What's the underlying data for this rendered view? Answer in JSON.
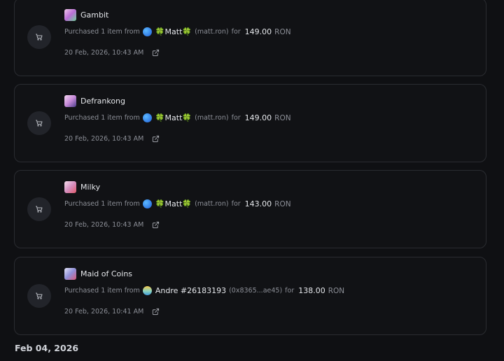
{
  "purchases": [
    {
      "item": "Gambit",
      "prefix": "Purchased 1 item from",
      "seller": "🍀Matt🍀",
      "handle": "(matt.ron)",
      "for": "for",
      "price": "149.00",
      "currency": "RON",
      "date": "20 Feb, 2026, 10:43 AM",
      "thumb_color": "#b96fd6",
      "avatar_color": "#2a7df0"
    },
    {
      "item": "Defrankong",
      "prefix": "Purchased 1 item from",
      "seller": "🍀Matt🍀",
      "handle": "(matt.ron)",
      "for": "for",
      "price": "149.00",
      "currency": "RON",
      "date": "20 Feb, 2026, 10:43 AM",
      "thumb_color": "#c68ad8",
      "avatar_color": "#2a7df0"
    },
    {
      "item": "Milky",
      "prefix": "Purchased 1 item from",
      "seller": "🍀Matt🍀",
      "handle": "(matt.ron)",
      "for": "for",
      "price": "143.00",
      "currency": "RON",
      "date": "20 Feb, 2026, 10:43 AM",
      "thumb_color": "#d48fbf",
      "avatar_color": "#2a7df0"
    },
    {
      "item": "Maid of Coins",
      "prefix": "Purchased 1 item from",
      "seller": "Andre #26183193",
      "handle": "(0x8365...ae45)",
      "for": "for",
      "price": "138.00",
      "currency": "RON",
      "date": "20 Feb, 2026, 10:41 AM",
      "thumb_color": "#8f8fd8",
      "avatar_color": "#e8c24a"
    }
  ],
  "section_date": "Feb 04, 2026",
  "icons": {
    "cart": "cart-icon",
    "external": "external-link-icon"
  }
}
